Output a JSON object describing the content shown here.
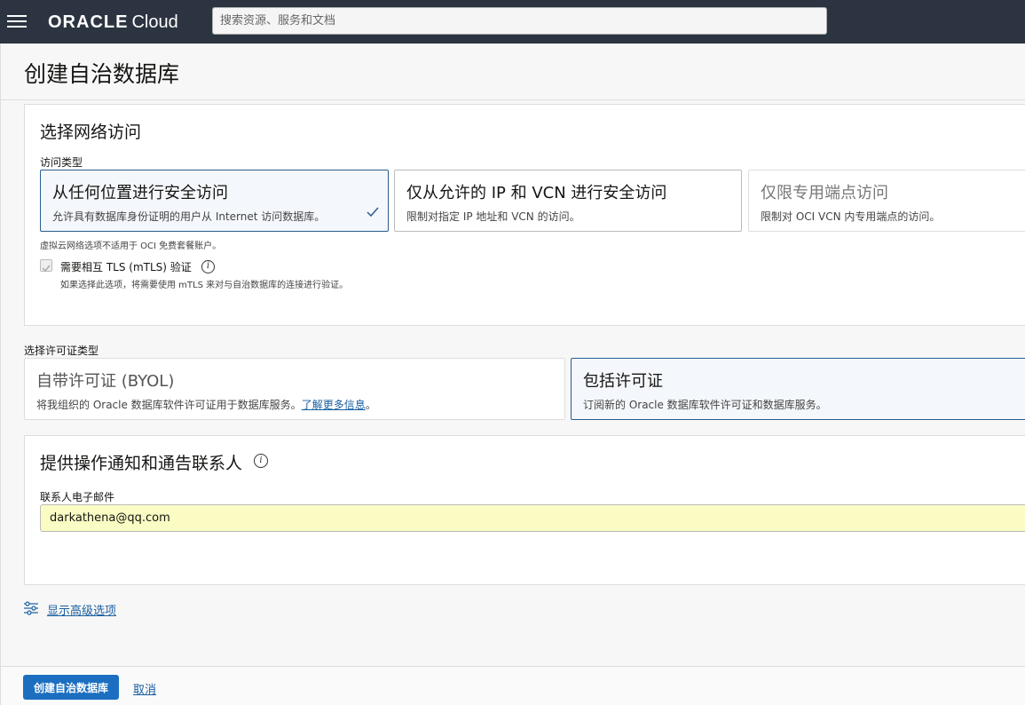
{
  "topbar": {
    "brand_main": "ORACLE",
    "brand_sub": "Cloud",
    "search_placeholder": "搜索资源、服务和文档"
  },
  "page": {
    "title": "创建自治数据库"
  },
  "network": {
    "title": "选择网络访问",
    "access_type_label": "访问类型",
    "options": [
      {
        "title": "从任何位置进行安全访问",
        "desc": "允许具有数据库身份证明的用户从 Internet 访问数据库。",
        "selected": true
      },
      {
        "title": "仅从允许的 IP 和 VCN 进行安全访问",
        "desc": "限制对指定 IP 地址和 VCN 的访问。",
        "selected": false
      },
      {
        "title": "仅限专用端点访问",
        "desc": "限制对 OCI VCN 内专用端点的访问。",
        "selected": false,
        "disabled": true
      }
    ],
    "vcn_note": "虚拟云网络选项不适用于 OCI 免费套餐账户。",
    "mtls_label": "需要相互 TLS (mTLS) 验证",
    "mtls_help": "如果选择此选项，将需要使用 mTLS 来对与自治数据库的连接进行验证。"
  },
  "license": {
    "label": "选择许可证类型",
    "options": [
      {
        "title": "自带许可证 (BYOL)",
        "desc": "将我组织的 Oracle 数据库软件许可证用于数据库服务。",
        "link": "了解更多信息",
        "period": "。"
      },
      {
        "title": "包括许可证",
        "desc": "订阅新的 Oracle 数据库软件许可证和数据库服务。"
      }
    ]
  },
  "contact": {
    "title": "提供操作通知和通告联系人",
    "email_label": "联系人电子邮件",
    "email_value": "darkathena@qq.com"
  },
  "advanced": {
    "label": "显示高级选项"
  },
  "footer": {
    "create_label": "创建自治数据库",
    "cancel_label": "取消"
  },
  "colors": {
    "topbar": "#2b3440",
    "primary": "#1c6fc0",
    "selected_border": "#2a5d8f",
    "email_bg": "#fafcc4"
  }
}
